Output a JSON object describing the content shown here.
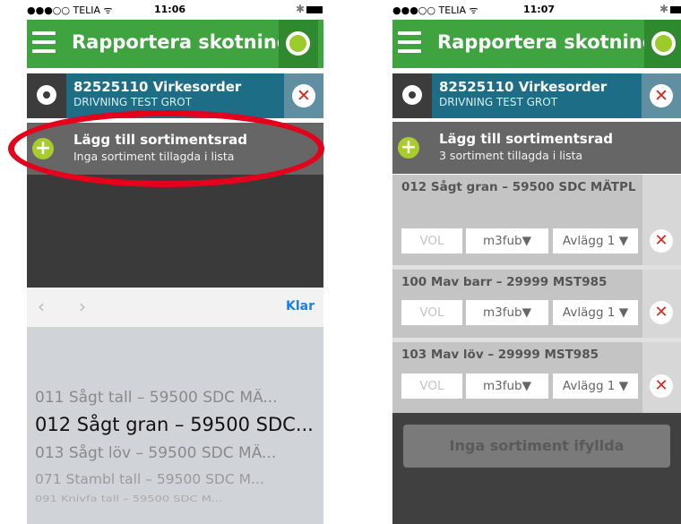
{
  "phone1": {
    "status": {
      "carrier": "●●●○○ TELIA ᯤ",
      "time": "11:06"
    },
    "title": "Rapportera skotning",
    "order": {
      "title": "82525110 Virkesorder",
      "subtitle": "DRIVNING TEST GROT"
    },
    "add": {
      "title": "Lägg till sortimentsrad",
      "subtitle": "Inga sortiment tillagda i lista"
    },
    "toolbar": {
      "prev": "‹",
      "next": "›",
      "done": "Klar"
    },
    "picker": {
      "items": [
        "011 Sågt tall – 59500 SDC MÄ...",
        "012 Sågt gran – 59500 SDC...",
        "013 Sågt löv – 59500 SDC MÄ...",
        "071 Stambl tall – 59500 SDC M...",
        "091 Knivfa tall – 59500 SDC M..."
      ],
      "selected_index": 1
    }
  },
  "phone2": {
    "status": {
      "carrier": "●●●○○ TELIA ᯤ",
      "time": "11:07"
    },
    "title": "Rapportera skotning",
    "order": {
      "title": "82525110 Virkesorder",
      "subtitle": "DRIVNING TEST GROT"
    },
    "add": {
      "title": "Lägg till sortimentsrad",
      "subtitle": "3 sortiment tillagda i lista"
    },
    "rows": [
      {
        "title": "012 Sågt gran – 59500 SDC MÄTPL",
        "vol": "VOL",
        "unit": "m3fub▼",
        "avlagg": "Avlägg 1 ▼"
      },
      {
        "title": "100 Mav barr – 29999 MST985",
        "vol": "VOL",
        "unit": "m3fub▼",
        "avlagg": "Avlägg 1 ▼"
      },
      {
        "title": "103 Mav löv – 29999 MST985",
        "vol": "VOL",
        "unit": "m3fub▼",
        "avlagg": "Avlägg 1 ▼"
      }
    ],
    "button": "Inga sortiment ifyllda"
  },
  "colors": {
    "header_green": "#3fa33f",
    "order_teal": "#1d6d87",
    "highlight_red": "#e5001c",
    "delete_red": "#d9261c",
    "link_blue": "#1a7ef2"
  },
  "icons": [
    "menu-icon",
    "status-light-icon",
    "gear-icon",
    "close-icon",
    "plus-icon",
    "chevron-left-icon",
    "chevron-right-icon"
  ]
}
